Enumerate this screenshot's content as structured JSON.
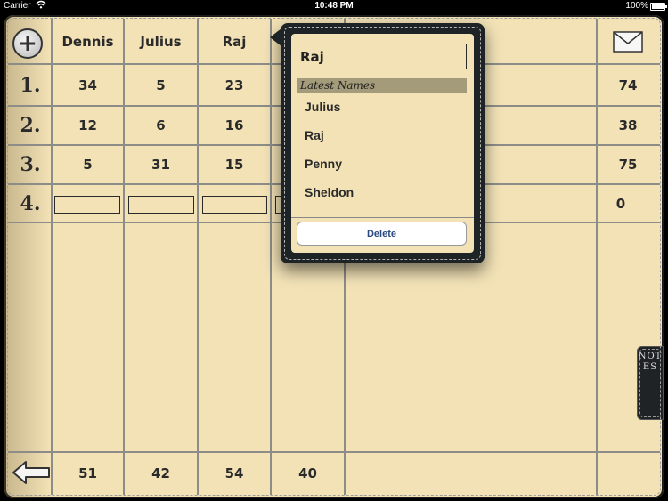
{
  "status_bar": {
    "carrier": "Carrier",
    "time": "10:48 PM",
    "battery": "100%"
  },
  "players": [
    "Dennis",
    "Julius",
    "Raj",
    ""
  ],
  "rows": [
    {
      "label": "1.",
      "scores": [
        "34",
        "5",
        "23",
        ""
      ],
      "total": "74"
    },
    {
      "label": "2.",
      "scores": [
        "12",
        "6",
        "16",
        ""
      ],
      "total": "38"
    },
    {
      "label": "3.",
      "scores": [
        "5",
        "31",
        "15",
        ""
      ],
      "total": "75"
    },
    {
      "label": "4.",
      "scores": [
        "",
        "",
        "",
        ""
      ],
      "total": "0"
    }
  ],
  "totals": [
    "51",
    "42",
    "54",
    "40"
  ],
  "notes_tab": "NOTES",
  "popover": {
    "input_value": "Raj",
    "latest_header": "Latest Names",
    "names": [
      "Julius",
      "Raj",
      "Penny",
      "Sheldon"
    ],
    "delete_label": "Delete"
  },
  "icons": {
    "add": "plus-circle-icon",
    "mail": "mail-icon",
    "back": "back-arrow-icon"
  }
}
